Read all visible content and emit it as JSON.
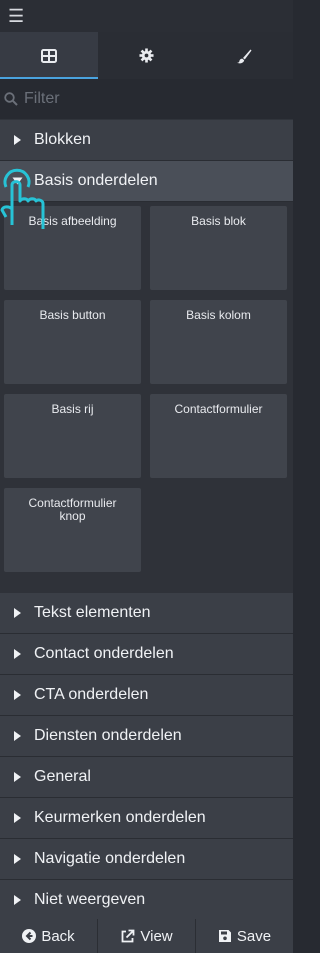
{
  "tabs": [
    {
      "icon": "grid-icon"
    },
    {
      "icon": "gear-icon"
    },
    {
      "icon": "brush-icon"
    }
  ],
  "filter": {
    "placeholder": "Filter"
  },
  "categories_top": [
    {
      "label": "Blokken"
    },
    {
      "label": "Basis onderdelen"
    }
  ],
  "blocks": [
    {
      "label": "Basis afbeelding"
    },
    {
      "label": "Basis blok"
    },
    {
      "label": "Basis button"
    },
    {
      "label": "Basis kolom"
    },
    {
      "label": "Basis rij"
    },
    {
      "label": "Contactformulier"
    },
    {
      "label": "Contactformulier knop"
    }
  ],
  "categories_bottom": [
    {
      "label": "Tekst elementen"
    },
    {
      "label": "Contact onderdelen"
    },
    {
      "label": "CTA onderdelen"
    },
    {
      "label": "Diensten onderdelen"
    },
    {
      "label": "General"
    },
    {
      "label": "Keurmerken onderdelen"
    },
    {
      "label": "Navigatie onderdelen"
    },
    {
      "label": "Niet weergeven"
    }
  ],
  "footer": {
    "back_label": "Back",
    "view_label": "View",
    "save_label": "Save"
  },
  "colors": {
    "accent": "#4aa3df",
    "cursor": "#27c3d6"
  }
}
